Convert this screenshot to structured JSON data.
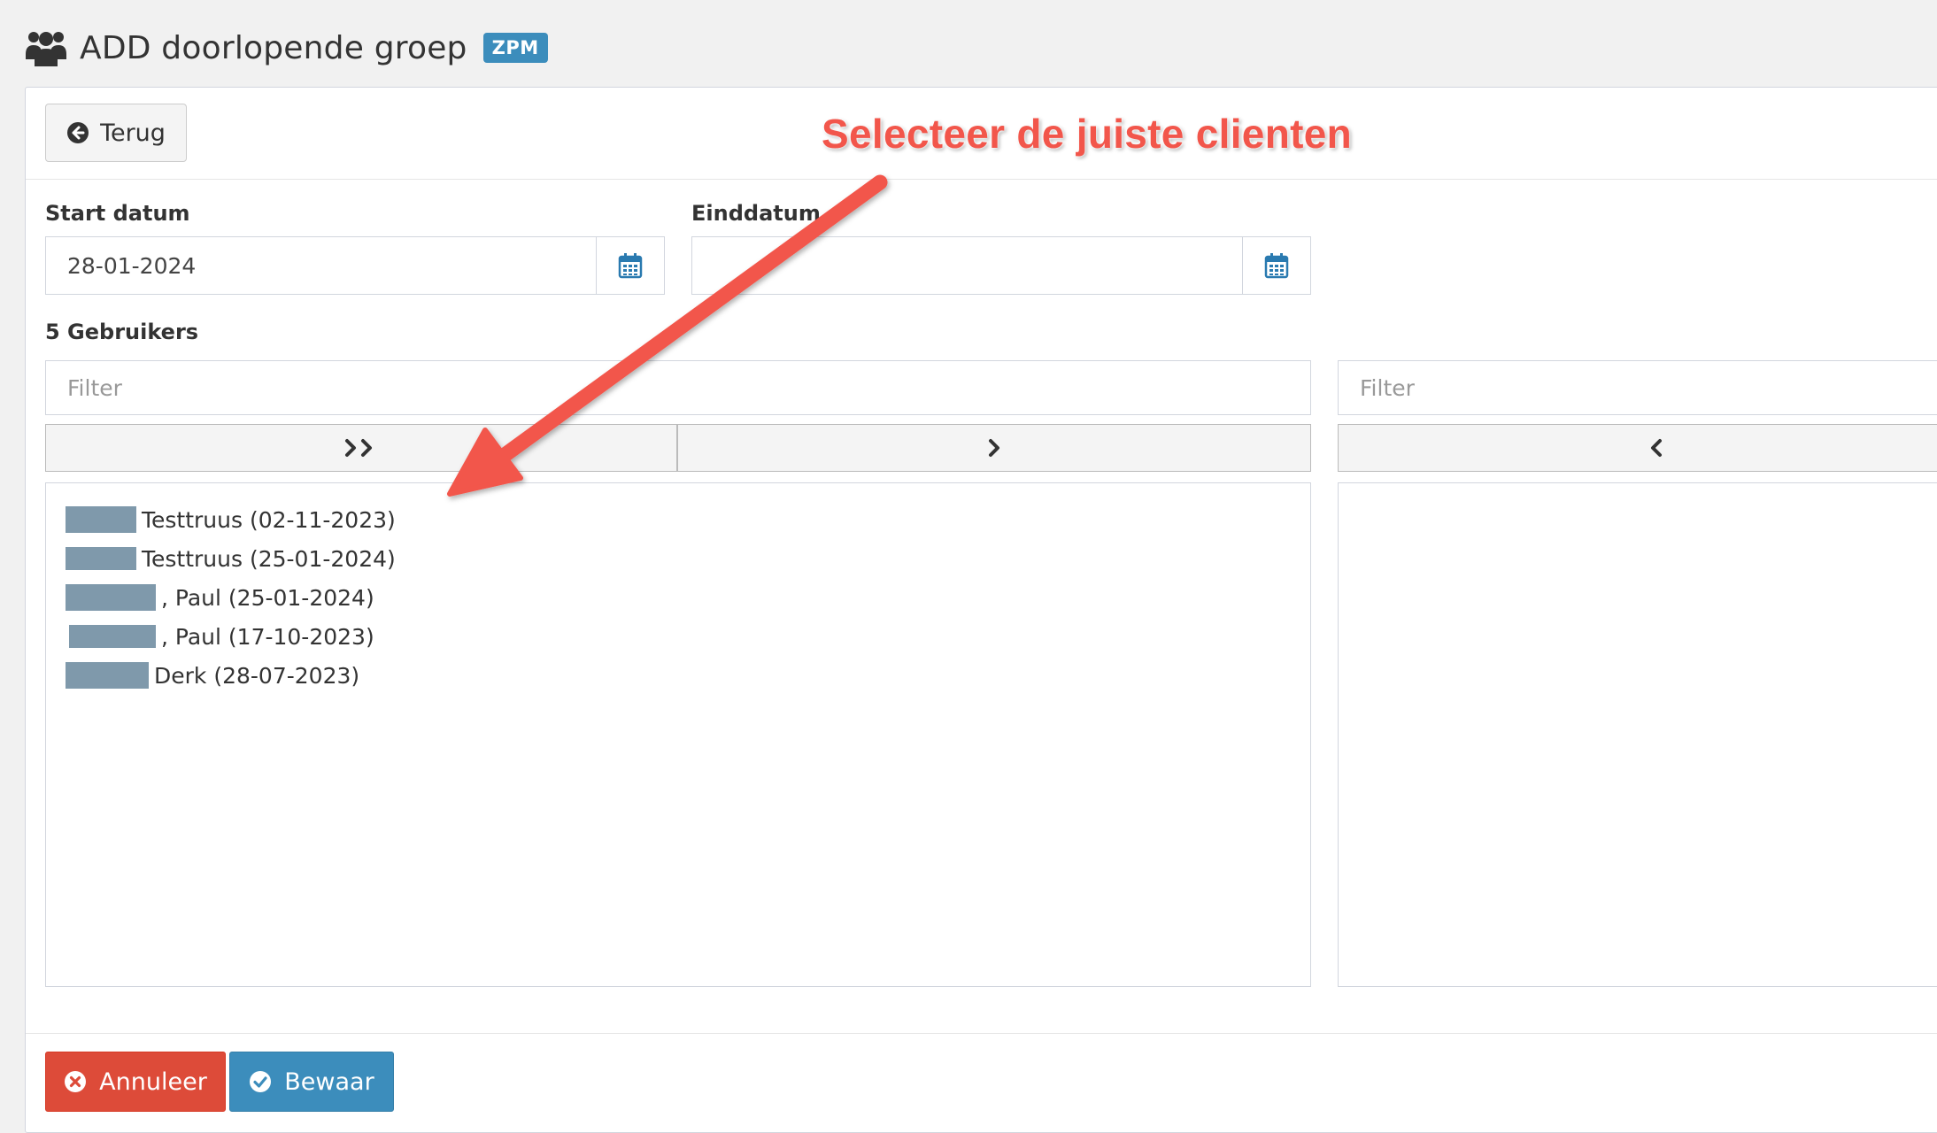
{
  "header": {
    "title": "ADD doorlopende groep",
    "badge": "ZPM",
    "icon": "users-icon"
  },
  "toolbar": {
    "back_label": "Terug"
  },
  "form": {
    "start_label": "Start datum",
    "start_value": "28-01-2024",
    "end_label": "Einddatum",
    "end_value": ""
  },
  "users": {
    "count_label": "5 Gebruikers",
    "left_filter_placeholder": "Filter",
    "right_filter_placeholder": "Filter",
    "items": [
      {
        "text": " Testtruus (02-11-2023)"
      },
      {
        "text": " Testtruus (25-01-2024)"
      },
      {
        "text": ", Paul (25-01-2024)"
      },
      {
        "text": ", Paul (17-10-2023)"
      },
      {
        "text": " Derk (28-07-2023)"
      }
    ]
  },
  "footer": {
    "cancel_label": "Annuleer",
    "save_label": "Bewaar"
  },
  "annotation": {
    "text": "Selecteer de juiste clienten",
    "color": "#f2564b"
  },
  "colors": {
    "primary": "#3c8dbc",
    "danger": "#dd4b39",
    "redaction": "#7f99ab"
  }
}
